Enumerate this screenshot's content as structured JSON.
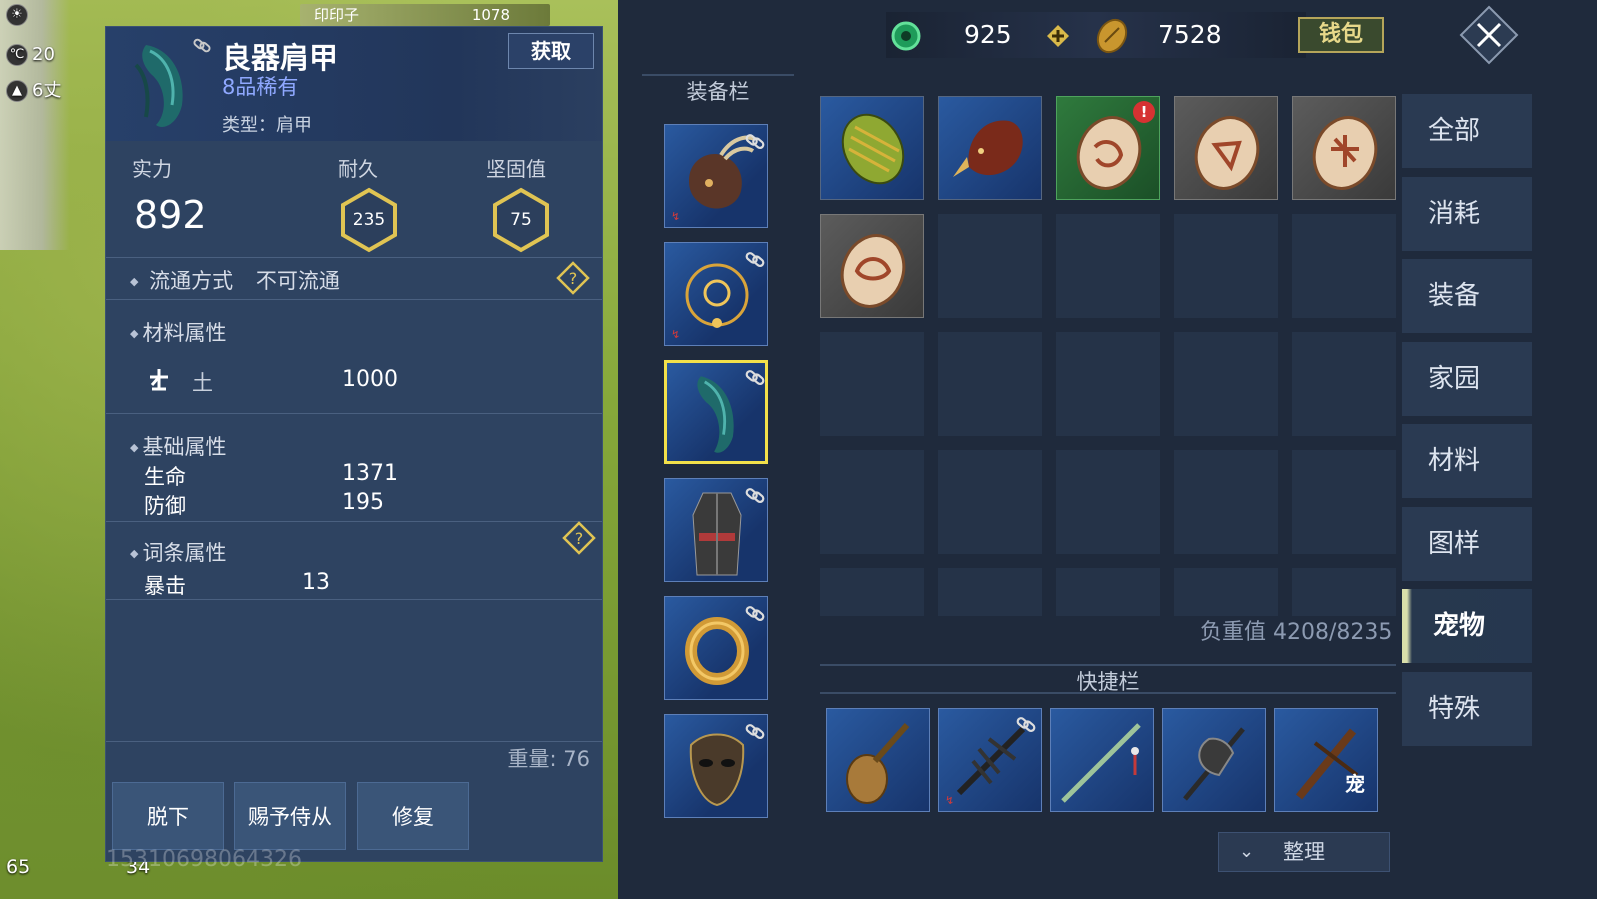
{
  "world": {
    "temperature": "20",
    "temp_unit": "℃",
    "altitude": "6丈",
    "strip_text": "印印子",
    "strip_value": "1078",
    "bottom_left_1": "65",
    "bottom_left_2": "34"
  },
  "detail": {
    "title": "良器肩甲",
    "rarity": "8品稀有",
    "type_label": "类型：",
    "type_value": "肩甲",
    "obtain_label": "获取",
    "power_label": "实力",
    "power_value": "892",
    "durability_label": "耐久",
    "durability_value": "235",
    "sturdy_label": "坚固值",
    "sturdy_value": "75",
    "circulation_label": "流通方式",
    "circulation_value": "不可流通",
    "material_title": "材料属性",
    "material_element": "土",
    "material_value": "1000",
    "base_title": "基础属性",
    "base_stats": [
      {
        "key": "生命",
        "value": "1371"
      },
      {
        "key": "防御",
        "value": "195"
      }
    ],
    "affix_title": "词条属性",
    "affix_stats": [
      {
        "key": "暴击",
        "value": "13"
      }
    ],
    "weight_text": "重量: 76",
    "buttons": [
      "脱下",
      "赐予侍从",
      "修复"
    ],
    "watermark": "15310698064326"
  },
  "inventory": {
    "currency_1": "925",
    "currency_2": "7528",
    "wallet_label": "钱包",
    "equip_title": "装备栏",
    "load_text": "负重值 4208/8235",
    "quick_title": "快捷栏",
    "sort_label": "整理",
    "tabs": [
      "全部",
      "消耗",
      "装备",
      "家园",
      "材料",
      "图样",
      "宠物",
      "特殊"
    ],
    "active_tab": "宠物",
    "quick_slot_5_tag": "宠",
    "alert_badge": "!"
  }
}
